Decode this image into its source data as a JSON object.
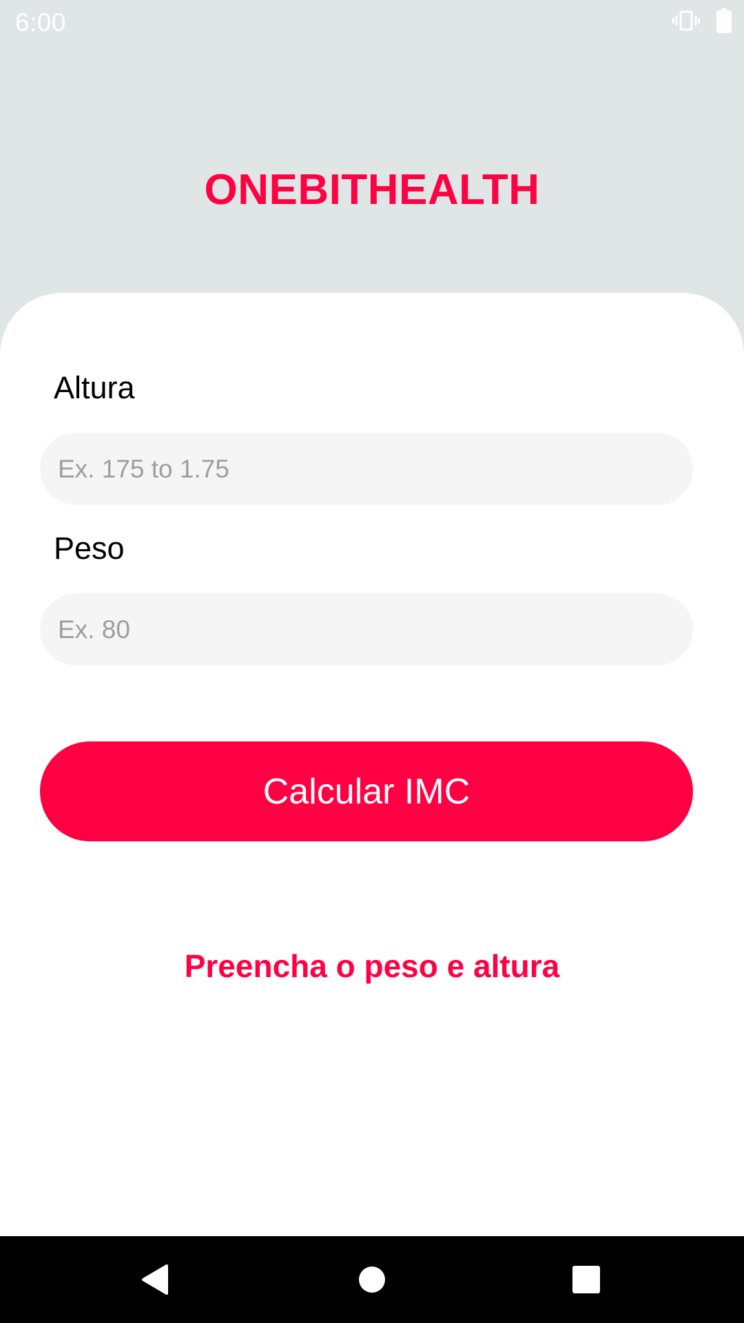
{
  "status_bar": {
    "time": "6:00",
    "icons": [
      "vibrate-icon",
      "battery-icon"
    ]
  },
  "header": {
    "title": "ONEBITHEALTH"
  },
  "form": {
    "height_label": "Altura",
    "height_value": "",
    "height_placeholder": "Ex. 175 to 1.75",
    "weight_label": "Peso",
    "weight_value": "",
    "weight_placeholder": "Ex. 80",
    "submit_label": "Calcular IMC"
  },
  "message": "Preencha o peso e altura",
  "nav_bar": {
    "icons": [
      "back-icon",
      "home-icon",
      "recents-icon"
    ]
  },
  "colors": {
    "accent": "#ff0043",
    "header_background": "#e0e5e5",
    "card_background": "#ffffff",
    "input_background": "#f5f5f5",
    "placeholder": "#9e9e9e",
    "nav_bar": "#000000"
  }
}
